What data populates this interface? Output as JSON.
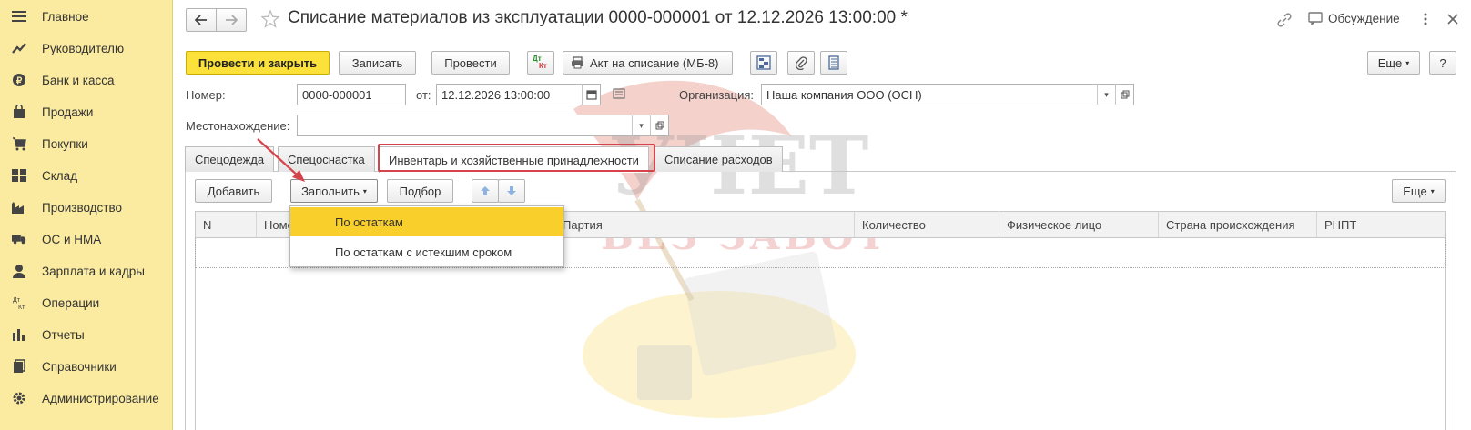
{
  "sidebar": {
    "items": [
      {
        "label": "Главное",
        "icon": "menu-icon"
      },
      {
        "label": "Руководителю",
        "icon": "trend-icon"
      },
      {
        "label": "Банк и касса",
        "icon": "coin-icon"
      },
      {
        "label": "Продажи",
        "icon": "bag-icon"
      },
      {
        "label": "Покупки",
        "icon": "cart-icon"
      },
      {
        "label": "Склад",
        "icon": "warehouse-icon"
      },
      {
        "label": "Производство",
        "icon": "factory-icon"
      },
      {
        "label": "ОС и НМА",
        "icon": "truck-icon"
      },
      {
        "label": "Зарплата и кадры",
        "icon": "person-icon"
      },
      {
        "label": "Операции",
        "icon": "dt-kt-icon"
      },
      {
        "label": "Отчеты",
        "icon": "bar-chart-icon"
      },
      {
        "label": "Справочники",
        "icon": "books-icon"
      },
      {
        "label": "Администрирование",
        "icon": "gear-icon"
      }
    ]
  },
  "header": {
    "title": "Списание материалов из эксплуатации 0000-000001 от 12.12.2026 13:00:00 *",
    "discussion": "Обсуждение"
  },
  "toolbar": {
    "post_close": "Провести и закрыть",
    "save": "Записать",
    "post": "Провести",
    "dtkt_top": "Дт",
    "dtkt_bottom": "Кт",
    "act": "Акт на списание (МБ-8)",
    "more": "Еще",
    "help": "?"
  },
  "form": {
    "number_label": "Номер:",
    "number_value": "0000-000001",
    "date_label": "от:",
    "date_value": "12.12.2026 13:00:00",
    "org_label": "Организация:",
    "org_value": "Наша компания ООО (ОСН)",
    "location_label": "Местонахождение:",
    "location_value": ""
  },
  "tabs": [
    {
      "label": "Спецодежда"
    },
    {
      "label": "Спецоснастка"
    },
    {
      "label": "Инвентарь и хозяйственные принадлежности"
    },
    {
      "label": "Списание расходов"
    }
  ],
  "table_toolbar": {
    "add": "Добавить",
    "fill": "Заполнить",
    "select": "Подбор",
    "more": "Еще"
  },
  "columns": [
    "N",
    "Номе",
    "Партия",
    "Количество",
    "Физическое лицо",
    "Страна происхождения",
    "РНПТ"
  ],
  "dropdown": {
    "items": [
      "По остаткам",
      "По остаткам с истекшим сроком"
    ]
  },
  "watermark": {
    "line1": "УЧЕТ",
    "line2": "БЕЗ ЗАБОТ"
  },
  "colors": {
    "sidebar_bg": "#fbeba0",
    "primary_button": "#fbe13a",
    "selected_item": "#f9cf2c",
    "highlight": "#d6434a"
  }
}
